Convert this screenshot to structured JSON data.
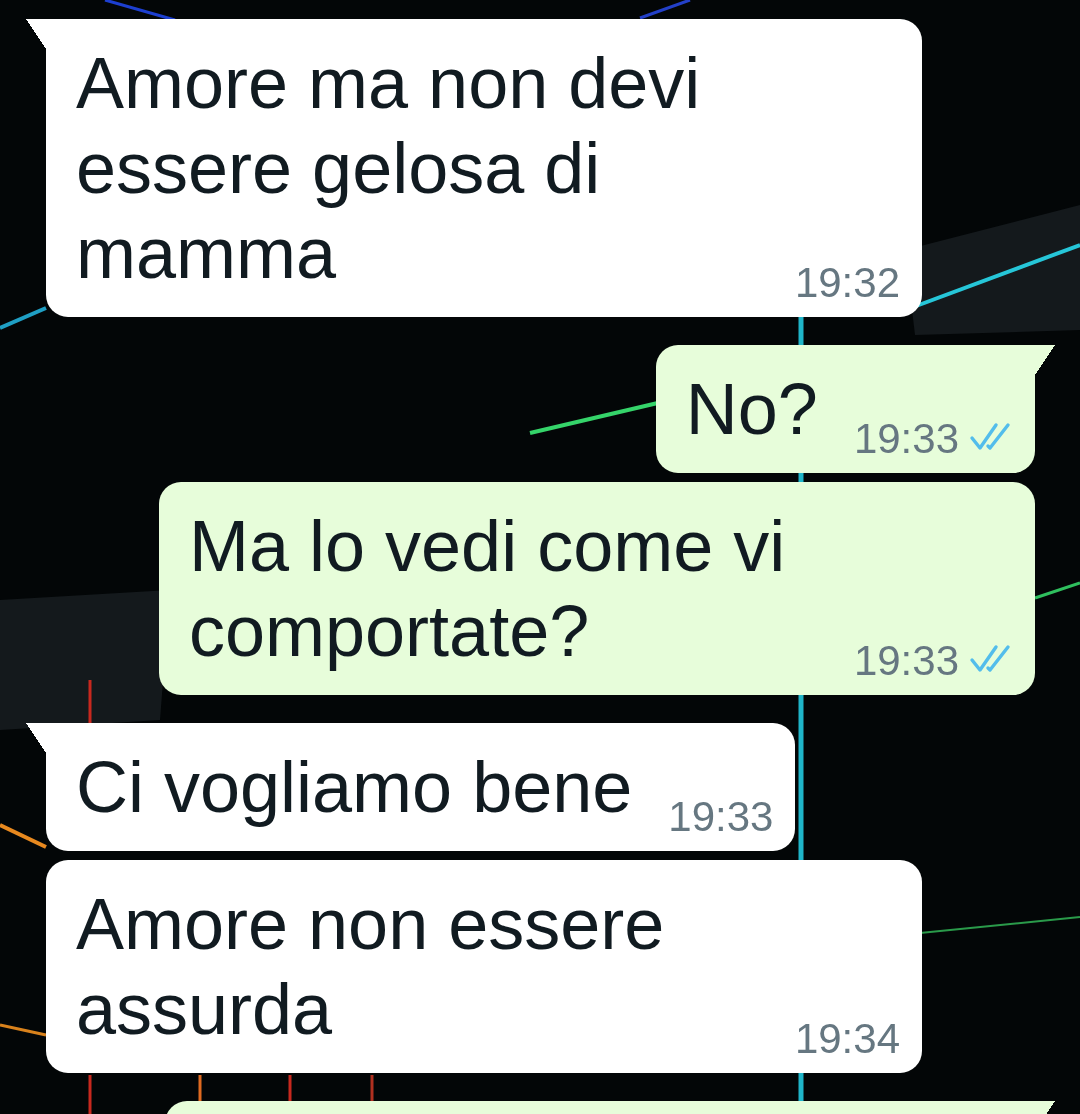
{
  "messages": [
    {
      "kind": "incoming",
      "tail": true,
      "text": "Amore ma non devi essere gelosa di mamma",
      "time": "19:32"
    },
    {
      "kind": "outgoing",
      "tail": true,
      "text": "No?",
      "time": "19:33",
      "read": true
    },
    {
      "kind": "outgoing",
      "tail": false,
      "text": "Ma lo vedi come vi comportate?",
      "time": "19:33",
      "read": true
    },
    {
      "kind": "incoming",
      "tail": true,
      "text": "Ci vogliamo bene",
      "time": "19:33"
    },
    {
      "kind": "incoming",
      "tail": false,
      "text": "Amore non essere assurda",
      "time": "19:34"
    },
    {
      "kind": "outgoing",
      "tail": true
    }
  ]
}
